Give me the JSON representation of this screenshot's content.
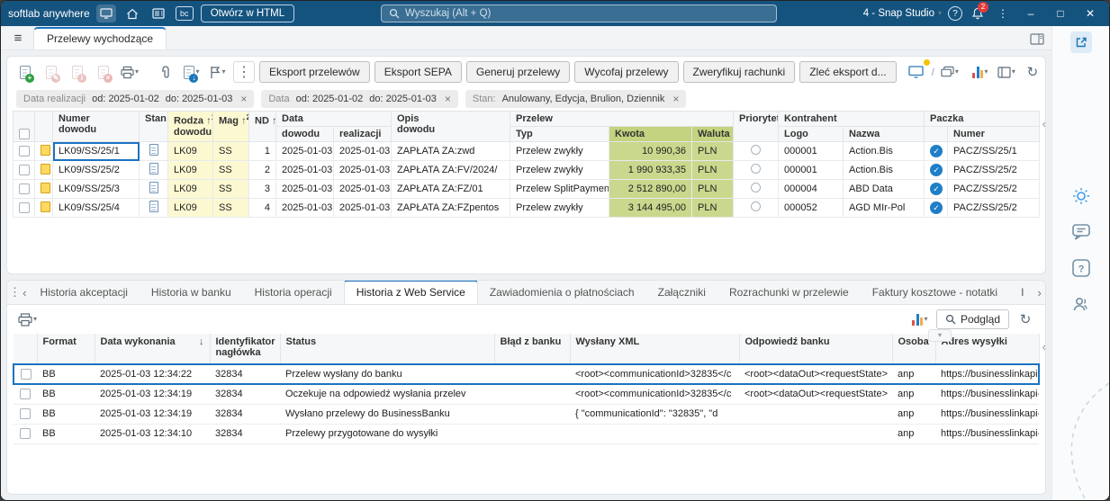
{
  "icons": {
    "check": "✓",
    "close": "×",
    "hamburger": "≡",
    "kebab": "⋮",
    "caret_down": "▾",
    "sort_up": "↑",
    "sort_down": "↓",
    "scroll_left": "‹",
    "scroll_right": "›",
    "refresh": "↻",
    "help": "?",
    "slash": "/",
    "minimize": "–",
    "maximize": "□",
    "close_window": "✕"
  },
  "titlebar": {
    "app_name": "softlab anywhere",
    "bc_label": "bc",
    "open_html_label": "Otwórz w HTML",
    "search_placeholder": "Wyszukaj (Alt + Q)",
    "profile_label": "4 - Snap Studio",
    "notification_badge": "2"
  },
  "tab_strip": {
    "active_tab": "Przelewy wychodzące"
  },
  "toolbar": {
    "action_buttons": [
      "Eksport przelewów",
      "Eksport SEPA",
      "Generuj przelewy",
      "Wycofaj przelewy",
      "Zweryfikuj rachunki",
      "Zleć eksport d..."
    ]
  },
  "filter_chips": [
    {
      "label": "Data realizacji",
      "from": "od: 2025-01-02",
      "to": "do: 2025-01-03"
    },
    {
      "label": "Data",
      "from": "od: 2025-01-02",
      "to": "do: 2025-01-03"
    },
    {
      "label": "Stan:",
      "value": "Anulowany, Edycja, Brulion, Dziennik"
    }
  ],
  "main_table": {
    "header": {
      "numer_l1": "Numer",
      "numer_l2": "dowodu",
      "stan": "Stan",
      "rodzaj_l1": "Rodza",
      "rodzaj_sort": "1",
      "rodzaj_l2": "dowodu",
      "mag": "Mag",
      "mag_sort": "2",
      "nd": "ND",
      "nd_sort": "3",
      "data_group": "Data",
      "data_dowodu": "dowodu",
      "data_realizacji": "realizacji",
      "opis_l1": "Opis",
      "opis_l2": "dowodu",
      "przelew_group": "Przelew",
      "typ": "Typ",
      "kwota": "Kwota",
      "waluta": "Waluta",
      "priorytet": "Priorytet",
      "kontrahent_group": "Kontrahent",
      "logo": "Logo",
      "nazwa": "Nazwa",
      "paczka_group": "Paczka",
      "paczka_numer": "Numer"
    },
    "rows": [
      {
        "numer": "LK09/SS/25/1",
        "rodzaj": "LK09",
        "mag": "SS",
        "nd": "1",
        "data_dowodu": "2025-01-03",
        "data_realizacji": "2025-01-03",
        "opis": "ZAPŁATA ZA:zwd",
        "typ": "Przelew zwykły",
        "kwota": "10 990,36",
        "waluta": "PLN",
        "logo": "000001",
        "nazwa": "Action.Bis",
        "paczka": "PACZ/SS/25/1"
      },
      {
        "numer": "LK09/SS/25/2",
        "rodzaj": "LK09",
        "mag": "SS",
        "nd": "2",
        "data_dowodu": "2025-01-03",
        "data_realizacji": "2025-01-03",
        "opis": "ZAPŁATA ZA:FV/2024/",
        "typ": "Przelew zwykły",
        "kwota": "1 990 933,35",
        "waluta": "PLN",
        "logo": "000001",
        "nazwa": "Action.Bis",
        "paczka": "PACZ/SS/25/2"
      },
      {
        "numer": "LK09/SS/25/3",
        "rodzaj": "LK09",
        "mag": "SS",
        "nd": "3",
        "data_dowodu": "2025-01-03",
        "data_realizacji": "2025-01-03",
        "opis": "ZAPŁATA ZA:FZ/01",
        "typ": "Przelew SplitPayment",
        "kwota": "2 512 890,00",
        "waluta": "PLN",
        "logo": "000004",
        "nazwa": "ABD Data",
        "paczka": "PACZ/SS/25/2"
      },
      {
        "numer": "LK09/SS/25/4",
        "rodzaj": "LK09",
        "mag": "SS",
        "nd": "4",
        "data_dowodu": "2025-01-03",
        "data_realizacji": "2025-01-03",
        "opis": "ZAPŁATA ZA:FZpentos",
        "typ": "Przelew zwykły",
        "kwota": "3 144 495,00",
        "waluta": "PLN",
        "logo": "000052",
        "nazwa": "AGD MIr-Pol",
        "paczka": "PACZ/SS/25/2"
      }
    ]
  },
  "detail_tabs": {
    "tabs": [
      "Historia akceptacji",
      "Historia w banku",
      "Historia operacji",
      "Historia z Web Service",
      "Zawiadomienia o płatnościach",
      "Załączniki",
      "Rozrachunki w przelewie",
      "Faktury kosztowe - notatki",
      "I"
    ]
  },
  "detail_toolbar": {
    "preview_label": "Podgląd"
  },
  "detail_table": {
    "header": {
      "format": "Format",
      "data_wykonania": "Data wykonania",
      "id_l1": "Identyfikator",
      "id_l2": "nagłówka",
      "status": "Status",
      "blad": "Błąd  z banku",
      "xml": "Wysłany XML",
      "odpowiedz": "Odpowiedź banku",
      "osoba": "Osoba",
      "adres": "Adres wysyłki"
    },
    "rows": [
      {
        "format": "BB",
        "data": "2025-01-03 12:34:22",
        "id": "32834",
        "status": "Przelew wysłany do banku",
        "blad": "",
        "xml": "<root><communicationId>32835</c",
        "odpowiedz": "<root><dataOut><requestState>",
        "osoba": "anp",
        "adres": "https://businesslinkapi-test.ass"
      },
      {
        "format": "BB",
        "data": "2025-01-03 12:34:19",
        "id": "32834",
        "status": "Oczekuje na odpowiedź wysłania przelev",
        "blad": "",
        "xml": "<root><communicationId>32835</c",
        "odpowiedz": "<root><dataOut><requestState>",
        "osoba": "anp",
        "adres": "https://businesslinkapi-test.ass"
      },
      {
        "format": "BB",
        "data": "2025-01-03 12:34:19",
        "id": "32834",
        "status": "Wysłano przelewy do BusinessBanku",
        "blad": "",
        "xml": "{  \"communicationId\": \"32835\",  \"d",
        "odpowiedz": "",
        "osoba": "anp",
        "adres": "https://businesslinkapi-test.ass"
      },
      {
        "format": "BB",
        "data": "2025-01-03 12:34:10",
        "id": "32834",
        "status": "Przelewy przygotowane do wysyłki",
        "blad": "",
        "xml": "",
        "odpowiedz": "",
        "osoba": "anp",
        "adres": "https://businesslinkapi-test.ass"
      }
    ]
  }
}
